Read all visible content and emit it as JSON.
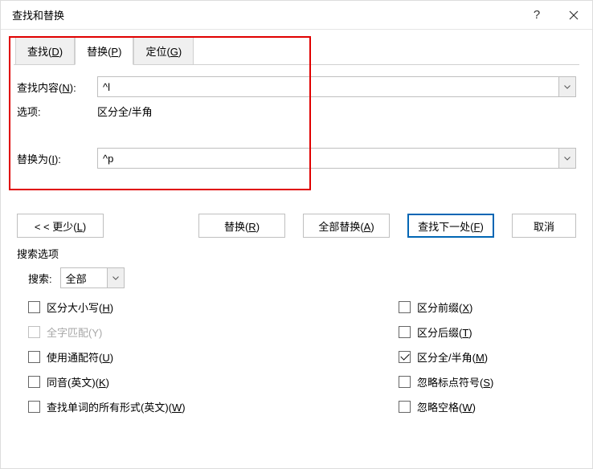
{
  "window": {
    "title": "查找和替换",
    "help": "?",
    "close": "×"
  },
  "tabs": {
    "find": {
      "pre": "查找(",
      "key": "D",
      "post": ")"
    },
    "replace": {
      "pre": "替换(",
      "key": "P",
      "post": ")"
    },
    "goto": {
      "pre": "定位(",
      "key": "G",
      "post": ")"
    }
  },
  "fields": {
    "find_label_pre": "查找内容(",
    "find_label_key": "N",
    "find_label_post": "):",
    "find_value": "^l",
    "options_label": "选项:",
    "options_value": "区分全/半角",
    "replace_label_pre": "替换为(",
    "replace_label_key": "I",
    "replace_label_post": "):",
    "replace_value": "^p"
  },
  "buttons": {
    "less": {
      "pre": "< < 更少(",
      "key": "L",
      "post": ")"
    },
    "replace": {
      "pre": "替换(",
      "key": "R",
      "post": ")"
    },
    "replace_all": {
      "pre": "全部替换(",
      "key": "A",
      "post": ")"
    },
    "find_next": {
      "pre": "查找下一处(",
      "key": "F",
      "post": ")"
    },
    "cancel": "取消"
  },
  "search_options": {
    "title": "搜索选项",
    "dir_label": "搜索:",
    "dir_value": "全部",
    "left": [
      {
        "pre": "区分大小写(",
        "key": "H",
        "post": ")",
        "checked": false,
        "disabled": false
      },
      {
        "pre": "全字匹配(Y)",
        "key": "",
        "post": "",
        "checked": false,
        "disabled": true
      },
      {
        "pre": "使用通配符(",
        "key": "U",
        "post": ")",
        "checked": false,
        "disabled": false
      },
      {
        "pre": "同音(英文)(",
        "key": "K",
        "post": ")",
        "checked": false,
        "disabled": false
      },
      {
        "pre": "查找单词的所有形式(英文)(",
        "key": "W",
        "post": ")",
        "checked": false,
        "disabled": false
      }
    ],
    "right": [
      {
        "pre": "区分前缀(",
        "key": "X",
        "post": ")",
        "checked": false
      },
      {
        "pre": "区分后缀(",
        "key": "T",
        "post": ")",
        "checked": false
      },
      {
        "pre": "区分全/半角(",
        "key": "M",
        "post": ")",
        "checked": true
      },
      {
        "pre": "忽略标点符号(",
        "key": "S",
        "post": ")",
        "checked": false
      },
      {
        "pre": "忽略空格(",
        "key": "W",
        "post": ")",
        "checked": false
      }
    ]
  }
}
